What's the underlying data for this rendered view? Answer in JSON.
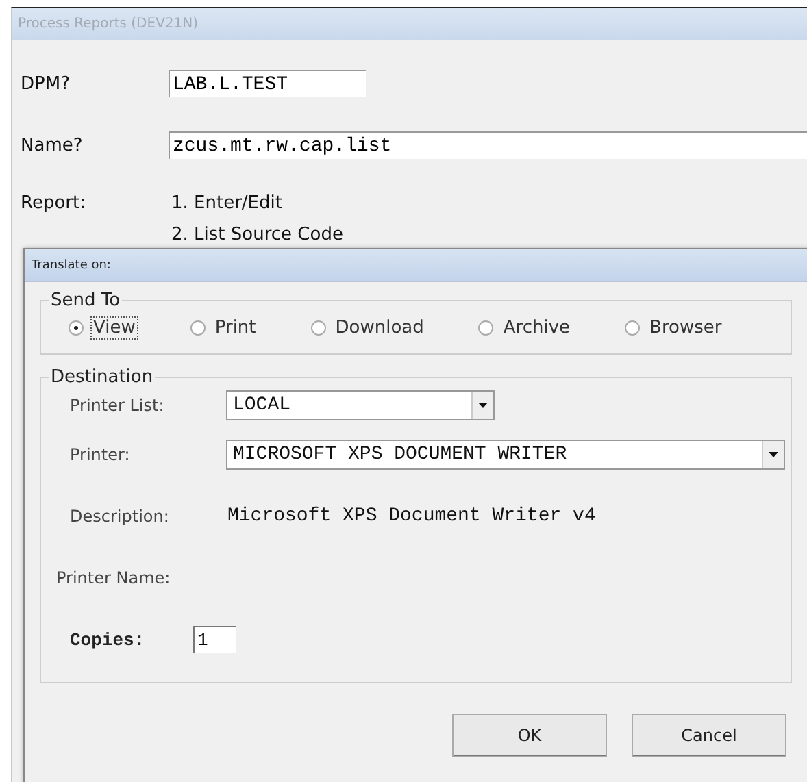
{
  "window": {
    "title": "Process Reports (DEV21N)"
  },
  "form": {
    "fields": [
      {
        "label": "DPM?",
        "value": "LAB.L.TEST",
        "kind": "short"
      },
      {
        "label": "Name?",
        "value": "zcus.mt.rw.cap.list",
        "kind": "long"
      }
    ],
    "report": {
      "label": "Report:",
      "options": [
        "1. Enter/Edit",
        "2. List Source Code"
      ]
    }
  },
  "dialog": {
    "title": "Translate on:",
    "send_to": {
      "legend": "Send To",
      "options": [
        {
          "label": "View",
          "selected": true
        },
        {
          "label": "Print",
          "selected": false
        },
        {
          "label": "Download",
          "selected": false
        },
        {
          "label": "Archive",
          "selected": false
        },
        {
          "label": "Browser",
          "selected": false
        }
      ]
    },
    "destination": {
      "legend": "Destination",
      "printer_list": {
        "label": "Printer List:",
        "value": "LOCAL"
      },
      "printer": {
        "label": "Printer:",
        "value": "MICROSOFT XPS DOCUMENT WRITER"
      },
      "description": {
        "label": "Description:",
        "value": "Microsoft XPS Document Writer v4"
      },
      "printer_name": {
        "label": "Printer Name:"
      },
      "copies": {
        "label": "Copies:",
        "value": "1"
      }
    },
    "buttons": [
      "OK",
      "Cancel"
    ]
  }
}
